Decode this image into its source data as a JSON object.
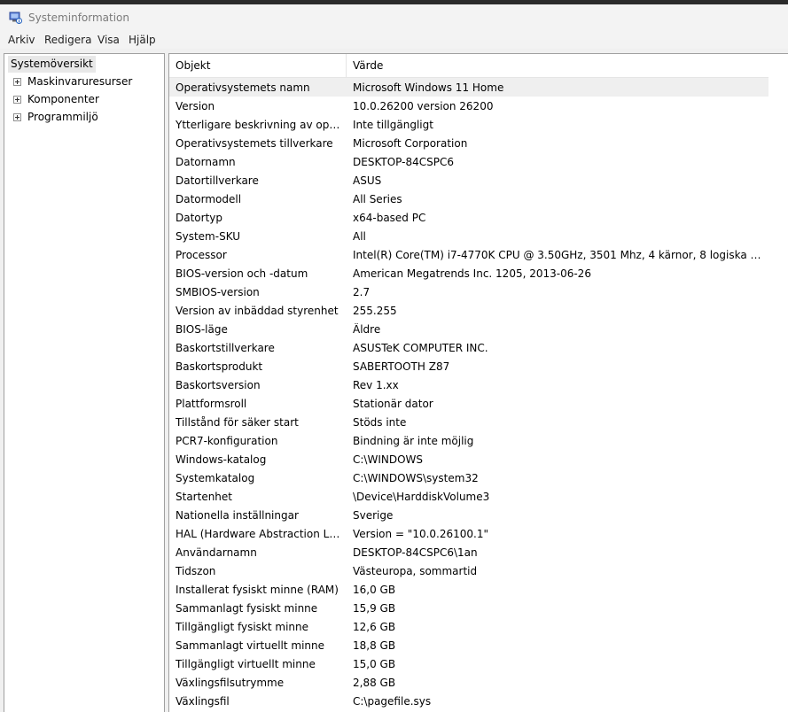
{
  "window": {
    "title": "Systeminformation",
    "icon": "system-information-icon"
  },
  "menu": [
    {
      "label": "Arkiv"
    },
    {
      "label": "Redigera"
    },
    {
      "label": "Visa"
    },
    {
      "label": "Hjälp"
    }
  ],
  "tree": {
    "root": "Systemöversikt",
    "children": [
      {
        "label": "Maskinvaruresurser"
      },
      {
        "label": "Komponenter"
      },
      {
        "label": "Programmiljö"
      }
    ]
  },
  "table": {
    "columns": [
      "Objekt",
      "Värde"
    ],
    "rows": [
      {
        "key": "Operativsystemets namn",
        "value": "Microsoft Windows 11 Home"
      },
      {
        "key": "Version",
        "value": "10.0.26200 version 26200"
      },
      {
        "key": "Ytterligare beskrivning av oper...",
        "value": "Inte tillgängligt"
      },
      {
        "key": "Operativsystemets tillverkare",
        "value": "Microsoft Corporation"
      },
      {
        "key": "Datornamn",
        "value": "DESKTOP-84CSPC6"
      },
      {
        "key": "Datortillverkare",
        "value": "ASUS"
      },
      {
        "key": "Datormodell",
        "value": "All Series"
      },
      {
        "key": "Datortyp",
        "value": "x64-based PC"
      },
      {
        "key": "System-SKU",
        "value": "All"
      },
      {
        "key": "Processor",
        "value": "Intel(R) Core(TM) i7-4770K CPU @ 3.50GHz, 3501 Mhz, 4 kärnor, 8 logiska pro..."
      },
      {
        "key": "BIOS-version och -datum",
        "value": "American Megatrends Inc. 1205, 2013-06-26"
      },
      {
        "key": "SMBIOS-version",
        "value": "2.7"
      },
      {
        "key": "Version av inbäddad styrenhet",
        "value": "255.255"
      },
      {
        "key": "BIOS-läge",
        "value": "Äldre"
      },
      {
        "key": "Baskortstillverkare",
        "value": "ASUSTeK COMPUTER INC."
      },
      {
        "key": "Baskortsprodukt",
        "value": "SABERTOOTH Z87"
      },
      {
        "key": "Baskortsversion",
        "value": "Rev 1.xx"
      },
      {
        "key": "Plattformsroll",
        "value": "Stationär dator"
      },
      {
        "key": "Tillstånd för säker start",
        "value": "Stöds inte"
      },
      {
        "key": "PCR7-konfiguration",
        "value": "Bindning är inte möjlig"
      },
      {
        "key": "Windows-katalog",
        "value": "C:\\WINDOWS"
      },
      {
        "key": "Systemkatalog",
        "value": "C:\\WINDOWS\\system32"
      },
      {
        "key": "Startenhet",
        "value": "\\Device\\HarddiskVolume3"
      },
      {
        "key": "Nationella inställningar",
        "value": "Sverige"
      },
      {
        "key": "HAL (Hardware Abstraction Lay...",
        "value": "Version = \"10.0.26100.1\""
      },
      {
        "key": "Användarnamn",
        "value": "DESKTOP-84CSPC6\\1an"
      },
      {
        "key": "Tidszon",
        "value": "Västeuropa, sommartid"
      },
      {
        "key": "Installerat fysiskt minne (RAM)",
        "value": "16,0 GB"
      },
      {
        "key": "Sammanlagt fysiskt minne",
        "value": "15,9 GB"
      },
      {
        "key": "Tillgängligt fysiskt minne",
        "value": "12,6 GB"
      },
      {
        "key": "Sammanlagt virtuellt minne",
        "value": "18,8 GB"
      },
      {
        "key": "Tillgängligt virtuellt minne",
        "value": "15,0 GB"
      },
      {
        "key": "Växlingsfilsutrymme",
        "value": "2,88 GB"
      },
      {
        "key": "Växlingsfil",
        "value": "C:\\pagefile.sys"
      }
    ]
  },
  "colors": {
    "selection": "#efefef",
    "border": "#a0a0a0",
    "title_text": "#7a7a7a"
  }
}
